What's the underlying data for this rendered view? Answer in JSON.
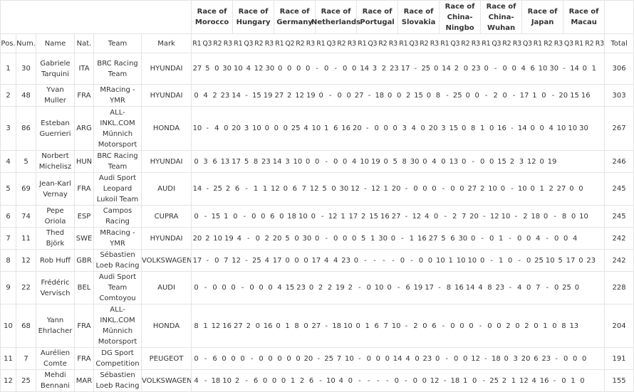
{
  "columns": {
    "pos": "Pos.",
    "num": "Num.",
    "name": "Name",
    "nat": "Nat.",
    "team": "Team",
    "mark": "Mark",
    "total": "Total"
  },
  "races": [
    {
      "name": "Race of Morocco",
      "subs": [
        "R1",
        "Q3",
        "R2",
        "R3"
      ]
    },
    {
      "name": "Race of Hungary",
      "subs": [
        "R1",
        "Q3",
        "R2",
        "R3"
      ]
    },
    {
      "name": "Race of Germany",
      "subs": [
        "R1",
        "Q2",
        "R2",
        "R3"
      ]
    },
    {
      "name": "Race of Netherlands",
      "subs": [
        "R1",
        "Q3",
        "R2",
        "R3"
      ]
    },
    {
      "name": "Race of Portugal",
      "subs": [
        "R1",
        "Q3",
        "R2",
        "R3"
      ]
    },
    {
      "name": "Race of Slovakia",
      "subs": [
        "R1",
        "Q3",
        "R2",
        "R3"
      ]
    },
    {
      "name": "Race of China-Ningbo",
      "subs": [
        "R1",
        "Q3",
        "R2",
        "R3"
      ]
    },
    {
      "name": "Race of China-Wuhan",
      "subs": [
        "R1",
        "Q3",
        "R2",
        "R3"
      ]
    },
    {
      "name": "Race of Japan",
      "subs": [
        "Q3",
        "R1",
        "R2",
        "R3"
      ]
    },
    {
      "name": "Race of Macau",
      "subs": [
        "Q3",
        "R1",
        "R2",
        "R3"
      ]
    }
  ],
  "rows": [
    {
      "pos": "1",
      "num": "30",
      "name": "Gabriele Tarquini",
      "nat": "ITA",
      "team": "BRC Racing Team",
      "mark": "HYUNDAI",
      "scores": [
        "27",
        "5",
        "0",
        "30",
        "10",
        "4",
        "12",
        "30",
        "0",
        "0",
        "0",
        "0",
        "-",
        "0",
        "-",
        "0",
        "0",
        "14",
        "3",
        "2",
        "23",
        "17",
        "-",
        "25",
        "0",
        "14",
        "2",
        "0",
        "23",
        "0",
        "-",
        "0",
        "0",
        "4",
        "6",
        "10",
        "30",
        "-",
        "14",
        "0",
        "1"
      ],
      "total": "306"
    },
    {
      "pos": "2",
      "num": "48",
      "name": "Yvan Muller",
      "nat": "FRA",
      "team": "MRacing - YMR",
      "mark": "HYUNDAI",
      "scores": [
        "0",
        "4",
        "2",
        "23",
        "14",
        "-",
        "15",
        "19",
        "27",
        "2",
        "12",
        "19",
        "0",
        "-",
        "0",
        "0",
        "27",
        "-",
        "18",
        "0",
        "0",
        "2",
        "15",
        "0",
        "8",
        "-",
        "25",
        "0",
        "0",
        "-",
        "2",
        "0",
        "-",
        "17",
        "1",
        "0",
        "-",
        "20",
        "15",
        "16"
      ],
      "total": "303"
    },
    {
      "pos": "3",
      "num": "86",
      "name": "Esteban Guerrieri",
      "nat": "ARG",
      "team": "ALL-INKL.COM Münnich Motorsport",
      "mark": "HONDA",
      "scores": [
        "10",
        "-",
        "4",
        "0",
        "20",
        "3",
        "10",
        "0",
        "0",
        "0",
        "25",
        "4",
        "10",
        "1",
        "6",
        "16",
        "20",
        "-",
        "0",
        "0",
        "0",
        "3",
        "4",
        "0",
        "20",
        "3",
        "15",
        "0",
        "8",
        "1",
        "0",
        "16",
        "-",
        "14",
        "0",
        "0",
        "4",
        "10",
        "10",
        "30"
      ],
      "total": "267"
    },
    {
      "pos": "4",
      "num": "5",
      "name": "Norbert Michelisz",
      "nat": "HUN",
      "team": "BRC Racing Team",
      "mark": "HYUNDAI",
      "scores": [
        "0",
        "3",
        "6",
        "13",
        "17",
        "5",
        "8",
        "23",
        "14",
        "3",
        "10",
        "0",
        "0",
        "-",
        "0",
        "0",
        "4",
        "10",
        "19",
        "0",
        "5",
        "8",
        "30",
        "0",
        "4",
        "0",
        "13",
        "0",
        "-",
        "0",
        "0",
        "15",
        "2",
        "3",
        "12",
        "0",
        "19"
      ],
      "total": "246"
    },
    {
      "pos": "5",
      "num": "69",
      "name": "Jean-Karl Vernay",
      "nat": "FRA",
      "team": "Audi Sport Leopard Lukoil Team",
      "mark": "AUDI",
      "scores": [
        "14",
        "-",
        "25",
        "2",
        "6",
        "-",
        "1",
        "1",
        "12",
        "0",
        "6",
        "7",
        "12",
        "5",
        "0",
        "30",
        "12",
        "-",
        "12",
        "1",
        "20",
        "-",
        "0",
        "0",
        "0",
        "-",
        "0",
        "0",
        "27",
        "2",
        "10",
        "0",
        "-",
        "10",
        "0",
        "1",
        "2",
        "27",
        "0",
        "0"
      ],
      "total": "245"
    },
    {
      "pos": "6",
      "num": "74",
      "name": "Pepe Oriola",
      "nat": "ESP",
      "team": "Campos Racing",
      "mark": "CUPRA",
      "scores": [
        "0",
        "-",
        "15",
        "1",
        "0",
        "-",
        "0",
        "0",
        "6",
        "0",
        "18",
        "10",
        "0",
        "-",
        "12",
        "1",
        "17",
        "2",
        "15",
        "16",
        "27",
        "-",
        "12",
        "4",
        "0",
        "-",
        "2",
        "7",
        "20",
        "-",
        "12",
        "10",
        "-",
        "2",
        "18",
        "0",
        "-",
        "8",
        "0",
        "10"
      ],
      "total": "245"
    },
    {
      "pos": "7",
      "num": "11",
      "name": "Thed Björk",
      "nat": "SWE",
      "team": "MRacing - YMR",
      "mark": "HYUNDAI",
      "scores": [
        "20",
        "2",
        "10",
        "19",
        "4",
        "-",
        "0",
        "2",
        "20",
        "5",
        "0",
        "30",
        "0",
        "-",
        "0",
        "0",
        "0",
        "5",
        "1",
        "30",
        "0",
        "-",
        "1",
        "16",
        "27",
        "5",
        "6",
        "30",
        "0",
        "-",
        "0",
        "1",
        "-",
        "0",
        "0",
        "4",
        "-",
        "0",
        "0",
        "4"
      ],
      "total": "242"
    },
    {
      "pos": "8",
      "num": "12",
      "name": "Rob Huff",
      "nat": "GBR",
      "team": "Sébastien Loeb Racing",
      "mark": "VOLKSWAGEN",
      "scores": [
        "17",
        "-",
        "0",
        "7",
        "12",
        "-",
        "25",
        "4",
        "17",
        "0",
        "0",
        "0",
        "17",
        "4",
        "4",
        "23",
        "0",
        "-",
        "-",
        "-",
        "-",
        "0",
        "-",
        "0",
        "0",
        "10",
        "1",
        "10",
        "10",
        "0",
        "-",
        "1",
        "0",
        "-",
        "0",
        "25",
        "10",
        "5",
        "17",
        "0",
        "23"
      ],
      "total": "242"
    },
    {
      "pos": "9",
      "num": "22",
      "name": "Frédéric Vervisch",
      "nat": "BEL",
      "team": "Audi Sport Team Comtoyou",
      "mark": "AUDI",
      "scores": [
        "0",
        "-",
        "0",
        "0",
        "0",
        "-",
        "0",
        "0",
        "0",
        "4",
        "15",
        "23",
        "0",
        "2",
        "2",
        "19",
        "2",
        "-",
        "0",
        "10",
        "0",
        "-",
        "6",
        "19",
        "17",
        "-",
        "8",
        "16",
        "14",
        "4",
        "8",
        "23",
        "-",
        "4",
        "0",
        "7",
        "-",
        "0",
        "25",
        "0"
      ],
      "total": "228"
    },
    {
      "pos": "10",
      "num": "68",
      "name": "Yann Ehrlacher",
      "nat": "FRA",
      "team": "ALL-INKL.COM Münnich Motorsport",
      "mark": "HONDA",
      "scores": [
        "8",
        "1",
        "12",
        "16",
        "27",
        "2",
        "0",
        "16",
        "0",
        "1",
        "8",
        "0",
        "27",
        "-",
        "18",
        "10",
        "0",
        "1",
        "6",
        "7",
        "10",
        "-",
        "2",
        "0",
        "6",
        "-",
        "0",
        "0",
        "0",
        "-",
        "0",
        "0",
        "2",
        "0",
        "2",
        "0",
        "1",
        "0",
        "8",
        "13"
      ],
      "total": "204"
    },
    {
      "pos": "11",
      "num": "7",
      "name": "Aurélien Comte",
      "nat": "FRA",
      "team": "DG Sport Competition",
      "mark": "PEUGEOT",
      "scores": [
        "0",
        "-",
        "6",
        "0",
        "0",
        "0",
        "-",
        "0",
        "0",
        "0",
        "0",
        "0",
        "20",
        "-",
        "25",
        "7",
        "10",
        "-",
        "0",
        "0",
        "0",
        "14",
        "4",
        "0",
        "23",
        "0",
        "-",
        "0",
        "0",
        "12",
        "-",
        "18",
        "0",
        "3",
        "20",
        "6",
        "23",
        "-",
        "0",
        "0",
        "0"
      ],
      "total": "191"
    },
    {
      "pos": "12",
      "num": "25",
      "name": "Mehdi Bennani",
      "nat": "MAR",
      "team": "Sébastien Loeb Racing",
      "mark": "VOLKSWAGEN",
      "scores": [
        "4",
        "-",
        "18",
        "10",
        "2",
        "-",
        "6",
        "0",
        "0",
        "0",
        "1",
        "2",
        "6",
        "-",
        "10",
        "4",
        "0",
        "-",
        "-",
        "-",
        "-",
        "0",
        "-",
        "0",
        "0",
        "12",
        "-",
        "18",
        "1",
        "0",
        "-",
        "25",
        "2",
        "1",
        "12",
        "4",
        "16",
        "-",
        "0",
        "1",
        "0"
      ],
      "total": "155"
    }
  ]
}
